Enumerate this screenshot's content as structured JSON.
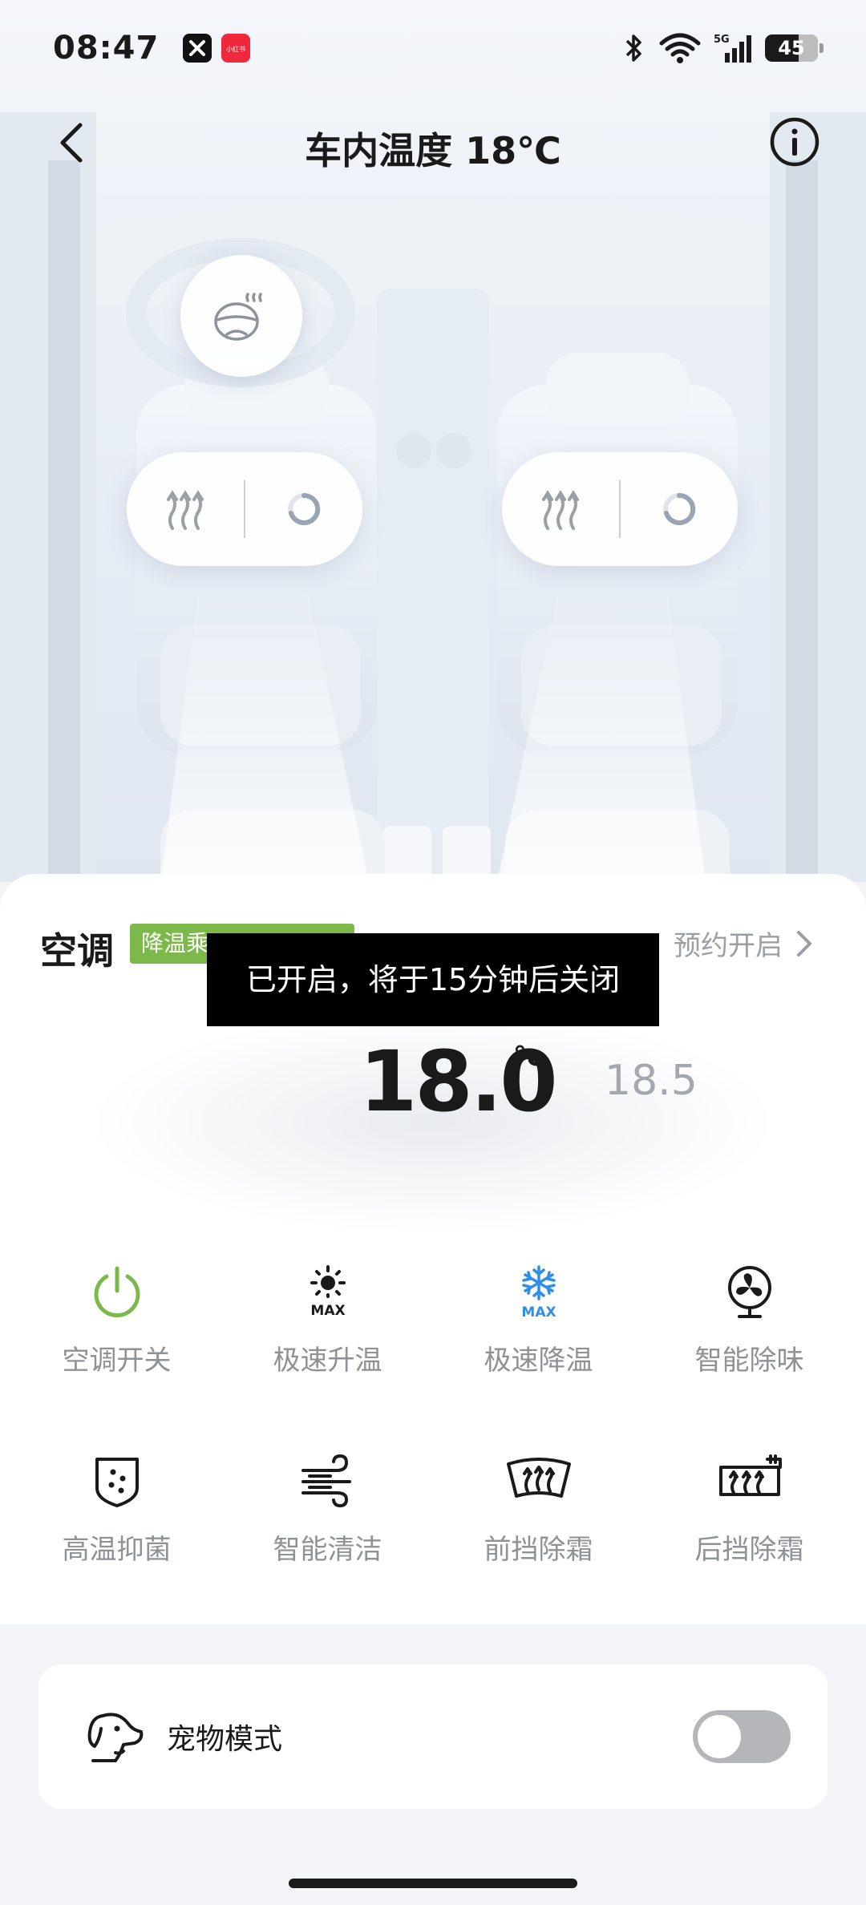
{
  "status_bar": {
    "time": "08:47",
    "notif_app_label": "小红书",
    "network": "5G",
    "battery": "45"
  },
  "header": {
    "title": "车内温度 18℃"
  },
  "ac": {
    "title": "空调",
    "tag": "降温乘",
    "schedule_label": "预约开启",
    "toast": "已开启，将于15分钟后关闭",
    "temp_main": "18.0",
    "temp_unit": "°c",
    "temp_side": "18.5",
    "functions_row1": [
      {
        "label": "空调开关",
        "icon": "power-icon"
      },
      {
        "label": "极速升温",
        "icon": "sun-max-icon"
      },
      {
        "label": "极速降温",
        "icon": "snowflake-max-icon"
      },
      {
        "label": "智能除味",
        "icon": "fan-icon"
      }
    ],
    "functions_row2": [
      {
        "label": "高温抑菌",
        "icon": "shield-dots-icon"
      },
      {
        "label": "智能清洁",
        "icon": "wind-icon"
      },
      {
        "label": "前挡除霜",
        "icon": "front-defrost-icon"
      },
      {
        "label": "后挡除霜",
        "icon": "rear-defrost-icon"
      }
    ],
    "max_text": "MAX",
    "colors": {
      "power": "#7cb94a",
      "cool": "#2f8fe8",
      "tag": "#7cb94a"
    }
  },
  "pet": {
    "label": "宠物模式",
    "enabled": false
  }
}
